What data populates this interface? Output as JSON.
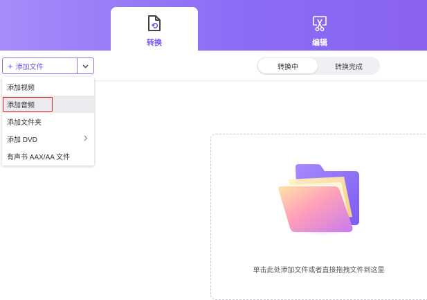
{
  "tabs": [
    {
      "label": "转换",
      "icon": "convert-file-icon",
      "active": true
    },
    {
      "label": "编辑",
      "icon": "edit-scissors-icon",
      "active": false
    }
  ],
  "toolbar": {
    "add_file_label": "添加文件",
    "add_icon": "plus-icon",
    "dropdown_icon": "chevron-down-icon",
    "segments": [
      "转换中",
      "转换完成"
    ]
  },
  "add_menu": {
    "items": [
      {
        "label": "添加视频"
      },
      {
        "label": "添加音频",
        "highlighted": true
      },
      {
        "label": "添加文件夹"
      },
      {
        "label": "添加 DVD",
        "has_submenu": true
      },
      {
        "label": "有声书 AAX/AA 文件"
      }
    ]
  },
  "drop_zone": {
    "hint": "单击此处添加文件或者直接拖拽文件到这里",
    "icon": "folder-icon"
  },
  "colors": {
    "accent": "#7a55ef",
    "header_start": "#a58bfb",
    "header_end": "#8a63ee",
    "highlight_border": "#e3242b"
  }
}
